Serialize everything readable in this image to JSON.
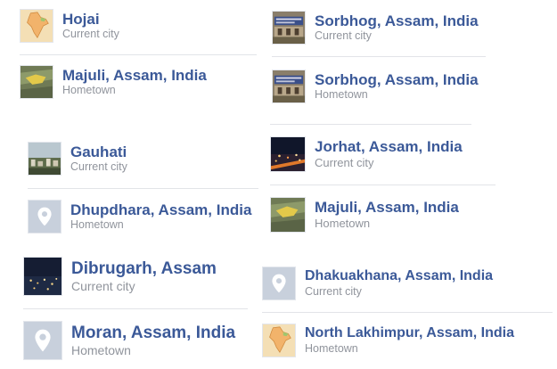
{
  "places": [
    {
      "name": "Hojai",
      "type": "Current city",
      "thumb": "india-map"
    },
    {
      "name": "Majuli, Assam, India",
      "type": "Hometown",
      "thumb": "majuli-map"
    },
    {
      "name": "Gauhati",
      "type": "Current city",
      "thumb": "city-photo"
    },
    {
      "name": "Dhupdhara, Assam, India",
      "type": "Hometown",
      "thumb": "location-pin-icon"
    },
    {
      "name": "Dibrugarh, Assam",
      "type": "Current city",
      "thumb": "night-city-photo"
    },
    {
      "name": "Moran, Assam, India",
      "type": "Hometown",
      "thumb": "location-pin-icon"
    },
    {
      "name": "Sorbhog, Assam, India",
      "type": "Current city",
      "thumb": "building-photo"
    },
    {
      "name": "Sorbhog, Assam, India",
      "type": "Hometown",
      "thumb": "building-photo"
    },
    {
      "name": "Jorhat, Assam, India",
      "type": "Current city",
      "thumb": "night-city-photo"
    },
    {
      "name": "Majuli, Assam, India",
      "type": "Hometown",
      "thumb": "majuli-map"
    },
    {
      "name": "Dhakuakhana, Assam, India",
      "type": "Current city",
      "thumb": "location-pin-icon"
    },
    {
      "name": "North Lakhimpur, Assam, India",
      "type": "Hometown",
      "thumb": "india-map"
    }
  ],
  "colors": {
    "link": "#3b5998",
    "subtext": "#90949c",
    "pin_background": "#c8d0dc"
  }
}
